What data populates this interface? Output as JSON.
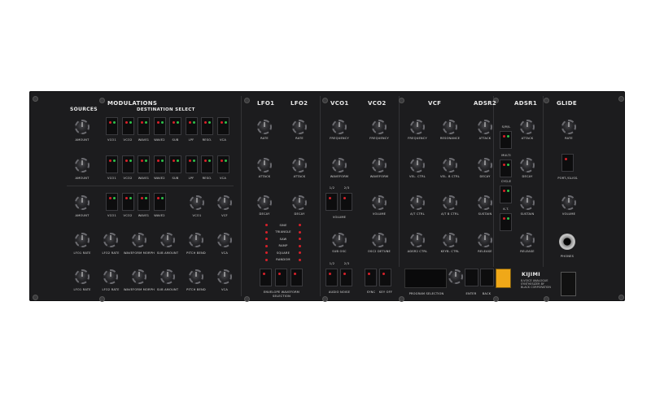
{
  "sections": {
    "modulations": "MODULATIONS",
    "sources": "SOURCES",
    "destination_select": "DESTINATION   SELECT",
    "lfo1": "LFO1",
    "lfo2": "LFO2",
    "vco1": "VCO1",
    "vco2": "VCO2",
    "vcf": "VCF",
    "adsr2": "ADSR2",
    "adsr1": "ADSR1",
    "glide": "GLIDE"
  },
  "mod_rows": [
    {
      "amount": "AMOUNT",
      "dests": [
        "VCO1",
        "VCO2",
        "WAVE1",
        "WAVE2",
        "SUB",
        "LPF",
        "RESO.",
        "VCA"
      ]
    },
    {
      "amount": "AMOUNT",
      "dests": [
        "VCO1",
        "VCO2",
        "WAVE1",
        "WAVE2",
        "SUB",
        "LPF",
        "RESO.",
        "VCA"
      ]
    },
    {
      "amount": "AMOUNT",
      "dests": [
        "VCO1",
        "VCO2",
        "WAVE1",
        "WAVE2"
      ]
    }
  ],
  "row3_knobs": [
    "VCO1",
    "VCF"
  ],
  "row4_knobs": [
    "LFO1 RATE",
    "LFO2 RATE",
    "WAVEFORM MORPH",
    "SUB AMOUNT",
    "PITCH BEND",
    "VCA"
  ],
  "row5_knobs": [
    "LFO1 RATE",
    "LFO2 RATE",
    "WAVEFORM MORPH",
    "SUB AMOUNT",
    "PITCH BEND",
    "VCA"
  ],
  "lfo_labels": {
    "rate1": "RATE",
    "rate2": "RATE",
    "attack1": "ATTACK",
    "attack2": "ATTACK",
    "decay1": "DECAY",
    "decay2": "DECAY"
  },
  "waveforms": [
    "SINE",
    "TRIANGLE",
    "SAW",
    "RAMP",
    "SQUARE",
    "RANDOM"
  ],
  "envelope_label": "ENVELOPE WAVEFORM SELECTION",
  "vco_labels": {
    "freq1": "FREQUENCY",
    "freq2": "FREQUENCY",
    "wave1": "WAVEFORM",
    "wave2": "WAVEFORM",
    "vol1": "VOLUME",
    "vol2": "VOLUME",
    "subosc": "SUB OSC",
    "detune": "OSC2 DETUNE"
  },
  "octave_btns": [
    "1/2",
    "2/3"
  ],
  "audio_btns": [
    "1/2",
    "2/3"
  ],
  "audio_noise": "AUDIO NOISE",
  "sync": "SYNC",
  "keyoff": "KEY OFF",
  "vcf_labels": {
    "frequency": "FREQUENCY",
    "resonance": "RESONANCE",
    "vel_ctrl": "VEL. CTRL",
    "vel_b_ctrl": "VEL. B CTRL",
    "at_ctrl": "A/T CTRL",
    "at_b_ctrl": "A/T B CTRL",
    "adsr2_ctrl": "ADSR2 CTRL",
    "keyb_ctrl": "KEYB. CTRL"
  },
  "adsr2_labels": {
    "attack": "ATTACK",
    "decay": "DECAY",
    "sustain": "SUSTAIN",
    "release": "RELEASE"
  },
  "adsr1_labels": {
    "attack": "ATTACK",
    "decay": "DECAY",
    "sustain": "SUSTAIN",
    "release": "RELEASE"
  },
  "adsr_switches": [
    "S/M/L",
    "MULTI",
    "CYCLE",
    "K.T."
  ],
  "glide_labels": {
    "rate": "RATE",
    "port": "PORT./GLISS.",
    "volume": "VOLUME",
    "phones": "PHONES"
  },
  "program_selection": "PROGRAM SELECTION",
  "enter": "ENTER",
  "back": "BACK",
  "brand": "KIJIMI",
  "brand_sub": "8-VOICE ANALOGUE SYNTHESIZER BY BLACK CORPORATION",
  "colors": {
    "led_red": "#d8202a",
    "led_green": "#2ec24a",
    "accent": "#f0a818"
  }
}
